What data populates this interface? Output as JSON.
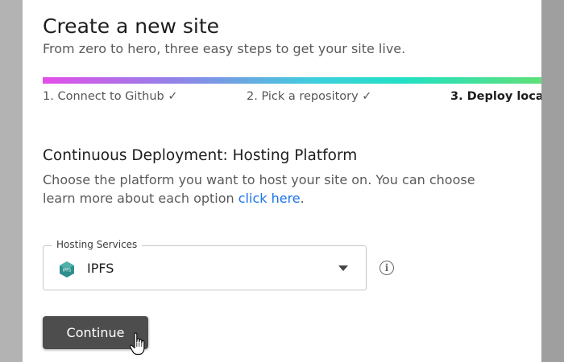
{
  "header": {
    "title": "Create a new site",
    "subtitle": "From zero to hero, three easy steps to get your site live."
  },
  "steps": [
    {
      "label": "1. Connect to Github ✓"
    },
    {
      "label": "2. Pick a repository ✓"
    },
    {
      "label": "3. Deploy loca"
    }
  ],
  "section": {
    "title": "Continuous Deployment: Hosting Platform",
    "desc_line1": "Choose the platform you want to host your site on. You can choose",
    "desc_line2_prefix": "learn more about each option ",
    "link_text": "click here",
    "desc_line2_suffix": "."
  },
  "hosting_select": {
    "label": "Hosting Services",
    "value": "IPFS",
    "icon": "ipfs-icon",
    "icon_text": "IPFS"
  },
  "info_icon": {
    "glyph": "i"
  },
  "continue_button": {
    "label": "Continue"
  },
  "colors": {
    "progress_gradient": [
      "#e34ee8",
      "#8d86e8",
      "#3ed0dc",
      "#22e0c4",
      "#5fe07a"
    ],
    "link": "#1a73e8",
    "button_bg": "#4d4d4d",
    "ipfs_teal": "#2f8f8f"
  }
}
